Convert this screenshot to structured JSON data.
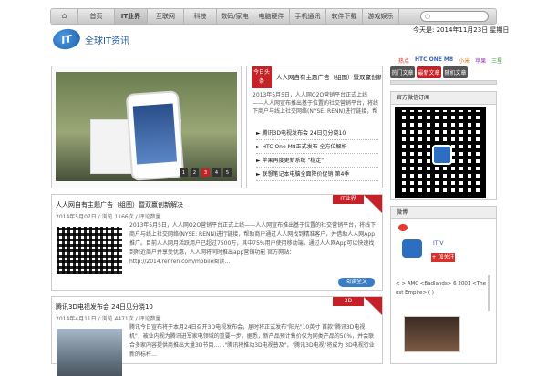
{
  "nav": {
    "items": [
      "首页",
      "IT业界",
      "互联网",
      "科技",
      "数码/家电",
      "电脑硬件",
      "手机通讯",
      "软件下载",
      "游戏娱乐"
    ],
    "active_index": 1,
    "search_placeholder": ""
  },
  "site": {
    "name": "全球IT资讯",
    "logo_text": "IT"
  },
  "header": {
    "date": "今天是: 2014年11月23日 星期日",
    "ticker": [
      "热点",
      "HTC ONE M8",
      "小米",
      "苹果",
      "三星"
    ]
  },
  "side_tabs": [
    "热门文章",
    "最新文章",
    "随机文章"
  ],
  "slider": {
    "pages": [
      "1",
      "2",
      "3",
      "4",
      "5"
    ],
    "active": 2
  },
  "lead": {
    "tag": "今日头条",
    "title": "人人网自有主题广告（组图）暨双赢创新解决",
    "summary": "2013年5月5日，人人网O2O营销平台正式上线——人人网宣布推出基于位置的社交营销平台，将线下商户与线上社交网络(NYSE: RENN)进行链接，帮助商户…",
    "links": [
      "腾讯3D电视发布会 24日见分晓10",
      "HTC One M8正式发布 全方位解析",
      "苹果再度更新系统 \"稳定\"",
      "联想笔记本电脑全面降价促销 第4季"
    ]
  },
  "sidebar": {
    "wechat_title": "官方微信订阅",
    "weibo_title": "微博",
    "weibo_name": "IT V",
    "weibo_follow": "+ 加关注",
    "weibo_text": "< > AMC <Badlands> 6 2001 <The Lost Empire> ( )"
  },
  "cards": [
    {
      "title": "人人网自有主题广告（组图）暨双赢创新解决",
      "tag": "IT业界",
      "meta": "2014年5月07日 / 浏览 1166次 / 评论数量",
      "body": "2013年5月5日，人人网O2O营销平台正式上线——人人网宣布推出基于位置的社交营销平台，将线下商户与线上社交网络(NYSE: RENN)进行链接，帮助商户通过人人网找到精准客户，并借助人人网App推广。目前人人网月活跃用户已超过7500万，其中75%用户使用移动端，通过人人网App可以快速找到附近商户并享受优惠，人人网将同时推出app营销功能 官方网站：http://2014.renren.com/mobile阅读…",
      "more": "阅读全文"
    },
    {
      "title": "腾讯3D电视发布会 24日见分晓10",
      "tag": "3D",
      "meta": "2014年4月11日 / 浏览 4471次 / 评论数量",
      "body": "腾讯今日宣布将于本月24日召开3D电视发布会，届时将正式发布\"阳光\"10英寸 首款\"腾讯3D电视机\"，被业内视为腾讯进军家电领域的重要一步。据悉，新产品预计售价仅为同类产品的50%，并会联合多家内容提供商推出大量3D节目……\"腾讯将推动3D电视普及\"，\"腾讯3D电视\"将成为 3D电视行业新的标杆…"
    }
  ]
}
